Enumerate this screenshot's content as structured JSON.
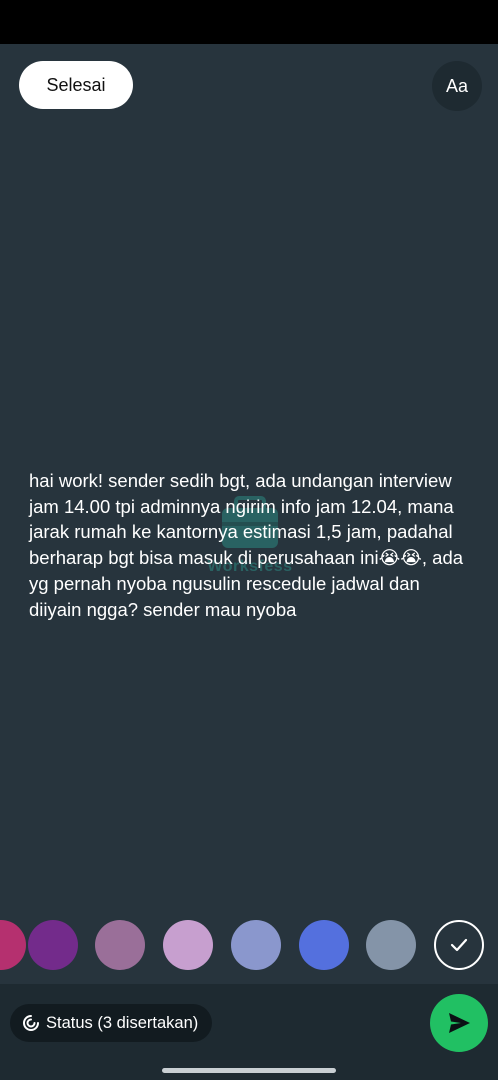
{
  "header": {
    "done_label": "Selesai",
    "font_label": "Aa"
  },
  "status_text": "hai work! sender sedih bgt, ada undangan interview jam 14.00 tpi adminnya ngirim info jam 12.04, mana jarak rumah ke kantornya estimasi 1,5 jam, padahal berharap bgt bisa masuk di perusahaan ini😭😭, ada yg pernah nyoba ngusulin rescedule jadwal dan diiyain ngga? sender mau nyoba",
  "watermark": {
    "label": "Worksfess"
  },
  "palette": {
    "colors": [
      "#b5306f",
      "#732b8b",
      "#9a6f99",
      "#c79fcf",
      "#8a97cd",
      "#5470de",
      "#8494a8"
    ],
    "selected": "#27343d"
  },
  "footer": {
    "audience_label": "Status (3 disertakan)",
    "audience_icon": "status-ring-icon",
    "send_icon": "send-icon"
  }
}
